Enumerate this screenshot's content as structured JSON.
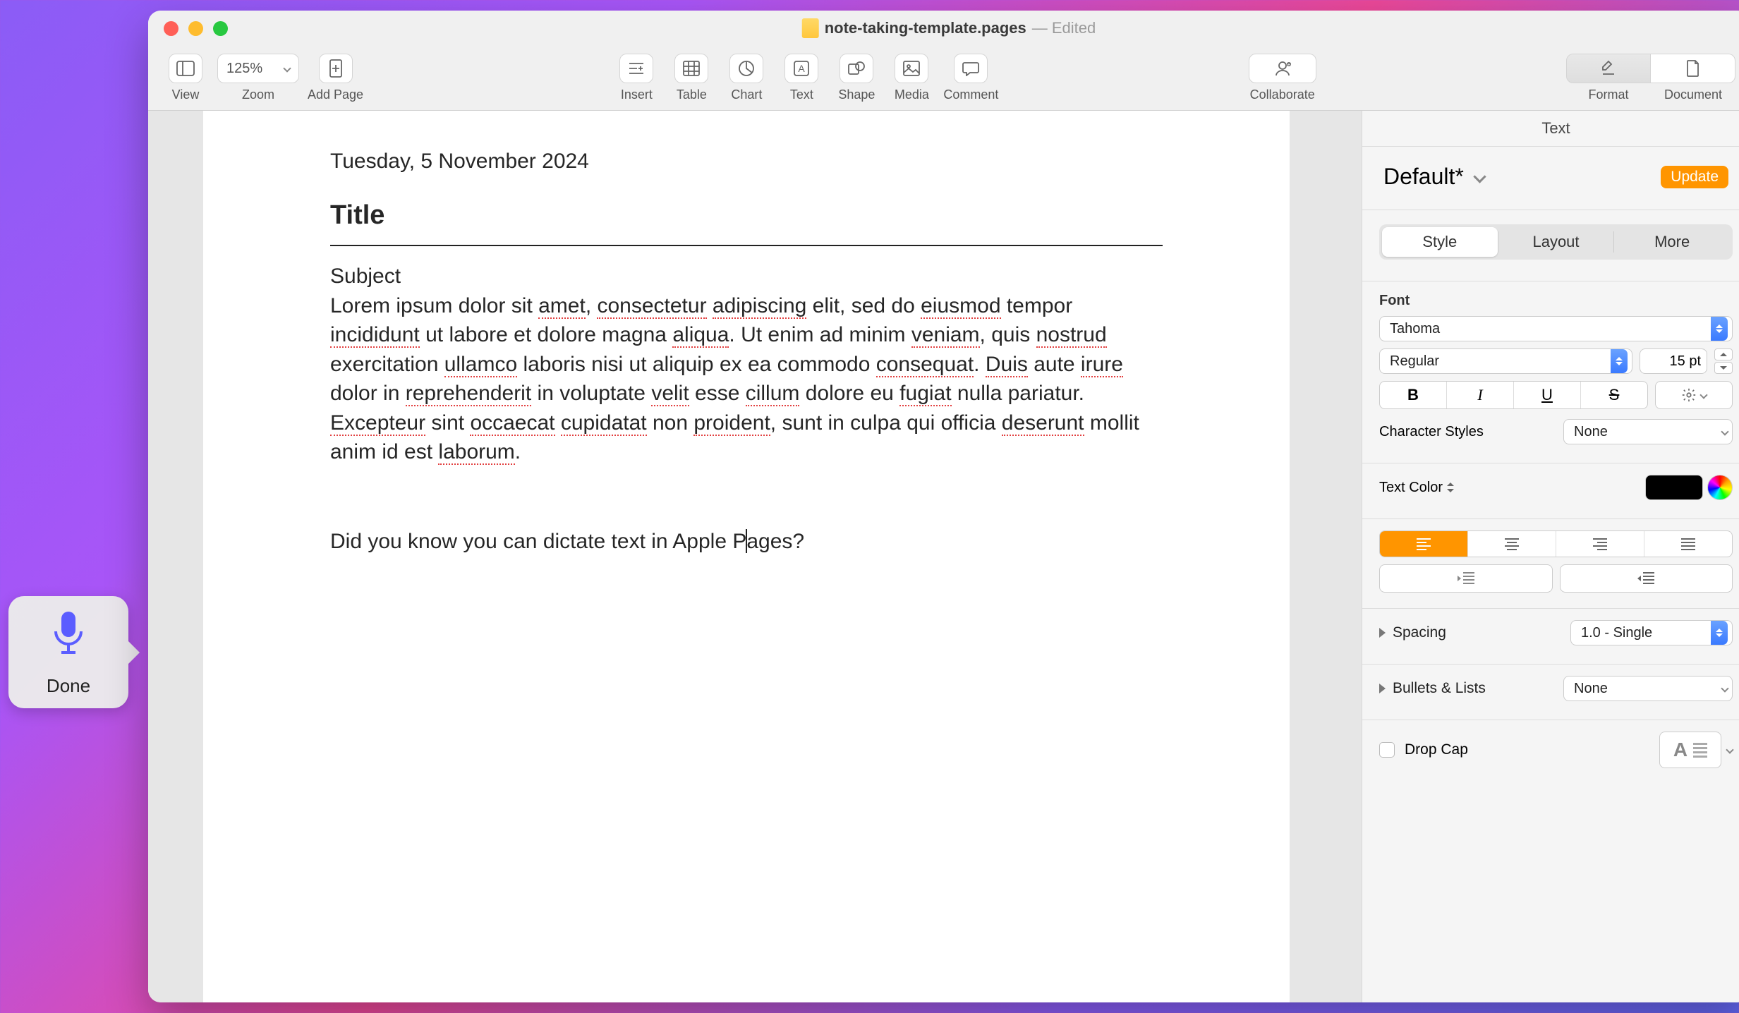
{
  "window": {
    "filename": "note-taking-template.pages",
    "status": "— Edited"
  },
  "toolbar": {
    "view": "View",
    "zoom_label": "Zoom",
    "zoom_value": "125%",
    "add_page": "Add Page",
    "insert": "Insert",
    "table": "Table",
    "chart": "Chart",
    "text": "Text",
    "shape": "Shape",
    "media": "Media",
    "comment": "Comment",
    "collaborate": "Collaborate",
    "format": "Format",
    "document": "Document"
  },
  "document": {
    "date": "Tuesday, 5 November 2024",
    "title": "Title",
    "subject": "Subject",
    "body_html": "Lorem ipsum dolor sit <span class='spell'>amet</span>, <span class='spell'>consectetur</span> <span class='spell'>adipiscing</span> elit, sed do <span class='spell'>eiusmod</span> tempor <span class='spell'>incididunt</span> ut labore et dolore magna <span class='spell'>aliqua</span>. Ut enim ad minim <span class='spell'>veniam</span>, quis <span class='spell'>nostrud</span> exercitation <span class='spell'>ullamco</span> laboris nisi ut aliquip ex ea commodo <span class='spell'>consequat</span>. <span class='spell'>Duis</span> aute <span class='spell'>irure</span> dolor in <span class='spell'>reprehenderit</span> in voluptate <span class='spell'>velit</span> esse <span class='spell'>cillum</span> dolore eu <span class='spell'>fugiat</span> nulla pariatur. <span class='spell'>Excepteur</span> sint <span class='spell'>occaecat</span> <span class='spell'>cupidatat</span> non <span class='spell'>proident</span>, sunt in culpa qui officia <span class='spell'>deserunt</span> mollit anim id est <span class='spell'>laborum</span>.",
    "dictate_pre": "Did you know you can dictate text in Apple P",
    "dictate_post": "ages?"
  },
  "inspector": {
    "tab": "Text",
    "style_name": "Default*",
    "update": "Update",
    "seg": {
      "style": "Style",
      "layout": "Layout",
      "more": "More"
    },
    "font_label": "Font",
    "font_family": "Tahoma",
    "font_weight": "Regular",
    "font_size": "15 pt",
    "bold": "B",
    "italic": "I",
    "underline": "U",
    "strike": "S",
    "char_styles_label": "Character Styles",
    "char_styles_value": "None",
    "text_color_label": "Text Color",
    "spacing_label": "Spacing",
    "spacing_value": "1.0 - Single",
    "bullets_label": "Bullets & Lists",
    "bullets_value": "None",
    "dropcap_label": "Drop Cap"
  },
  "dictation": {
    "done": "Done"
  }
}
